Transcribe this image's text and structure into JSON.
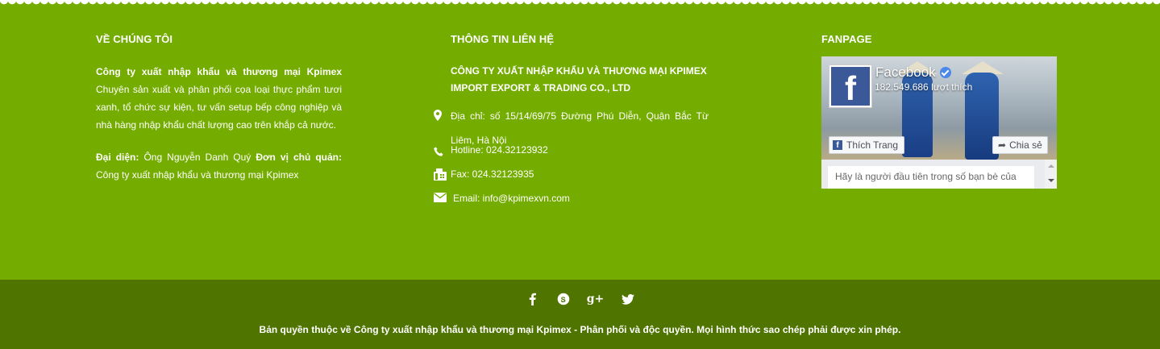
{
  "about": {
    "title": "VỀ CHÚNG TÔI",
    "company_bold": "Công ty xuất nhập khẩu và thương mại Kpimex",
    "description": "Chuyên sản xuất và phân phối cọa loại thực phẩm tươi xanh, tổ chức sự kiện, tư vấn setup bếp công nghiệp và nhà hàng nhập khẩu chất lượng cao trên khắp cả nước.",
    "rep_label": "Đại diện:",
    "rep_text": "Ông Nguyễn Danh Quý",
    "unit_label": "Đơn vị chủ quản:",
    "unit_text": "Công ty xuất nhập khẩu và thương mại Kpimex"
  },
  "contact": {
    "title": "THÔNG TIN LIÊN HỆ",
    "company_line1": "CÔNG TY XUẤT NHẬP KHẨU VÀ THƯƠNG MẠI KPIMEX",
    "company_line2": "IMPORT EXPORT & TRADING CO., LTD",
    "address_line1": "Địa chỉ: số 15/14/69/75 Đường Phú Diễn, Quận Bắc Từ",
    "address_line2": "Liêm, Hà Nội",
    "hotline": "Hotline: 024.32123932",
    "fax": "Fax: 024.32123935",
    "email": "Email: info@kpimexvn.com"
  },
  "fanpage": {
    "title": "FANPAGE",
    "page_name": "Facebook",
    "likes": "182.549.686 lượt thích",
    "like_button": "Thích Trang",
    "share_button": "Chia sẻ",
    "friends_text": "Hãy là người đầu tiên trong số bạn bè của"
  },
  "social": {
    "facebook": "f",
    "skype": "S",
    "googleplus": "g+",
    "twitter": "t"
  },
  "copyright": "Bản quyền thuộc về Công ty xuất nhập khẩu và thương mại Kpimex - Phân phối và độc quyền. Mọi hình thức sao chép phải được xin phép.",
  "colors": {
    "main_bg": "#74ad00",
    "bottom_bg": "#4f7500",
    "facebook_blue": "#3b5998"
  },
  "icons": [
    "map-marker-icon",
    "phone-icon",
    "fax-icon",
    "envelope-icon",
    "facebook-icon",
    "skype-icon",
    "google-plus-icon",
    "twitter-icon"
  ]
}
